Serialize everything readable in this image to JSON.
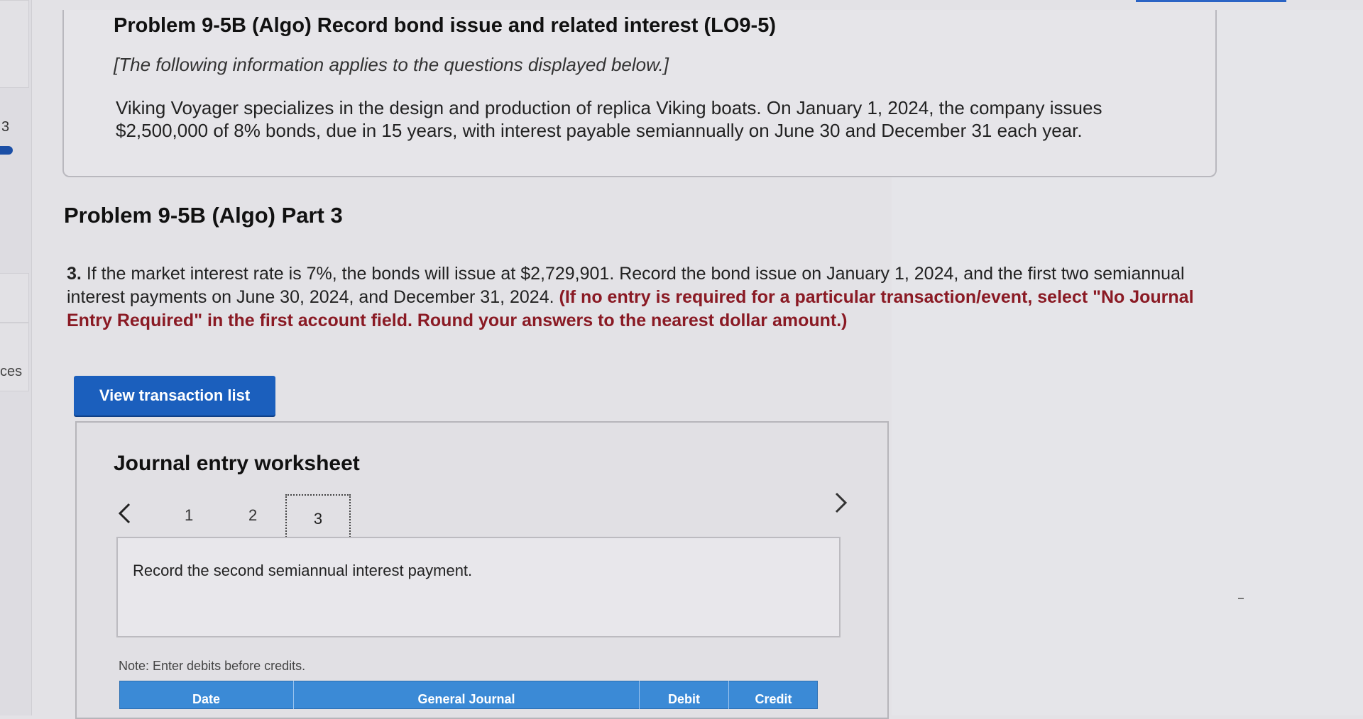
{
  "sidebar": {
    "number_fragment": "3",
    "label_fragment": "ces"
  },
  "intro": {
    "title": "Problem 9-5B (Algo) Record bond issue and related interest (LO9-5)",
    "note": "[The following information applies to the questions displayed below.]",
    "text": "Viking Voyager specializes in the design and production of replica Viking boats. On January 1, 2024, the company issues $2,500,000 of 8% bonds, due in 15 years, with interest payable semiannually on June 30 and December 31 each year."
  },
  "part": {
    "title": "Problem 9-5B (Algo) Part 3"
  },
  "question": {
    "number": "3.",
    "text": "If the market interest rate is 7%, the bonds will issue at $2,729,901. Record the bond issue on January 1, 2024, and the first two semiannual interest payments on June 30, 2024, and December 31, 2024.",
    "instructions": "(If no entry is required for a particular transaction/event, select \"No Journal Entry Required\" in the first account field. Round your answers to the nearest dollar amount.)"
  },
  "buttons": {
    "view_transactions": "View transaction list"
  },
  "worksheet": {
    "title": "Journal entry worksheet",
    "tabs": [
      "1",
      "2",
      "3"
    ],
    "active_tab": "3",
    "entry_text": "Record the second semiannual interest payment.",
    "note": "Note: Enter debits before credits.",
    "columns": [
      "Date",
      "General Journal",
      "Debit",
      "Credit"
    ]
  },
  "icons": {
    "prev": "chevron-left-icon",
    "next": "chevron-right-icon"
  },
  "colors": {
    "primary_button": "#1b5fbd",
    "table_header": "#3b8ad6",
    "instruction_text": "#8a1a24",
    "background": "#e3e2e6"
  }
}
